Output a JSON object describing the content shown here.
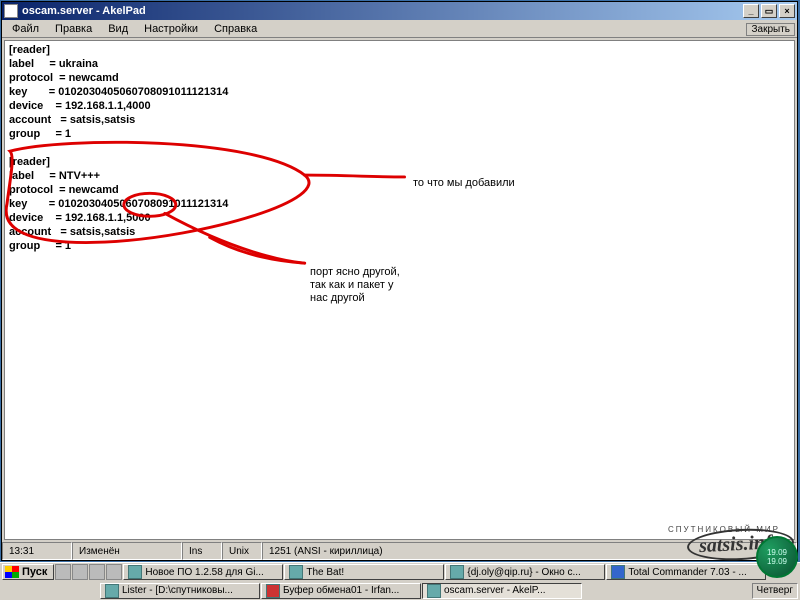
{
  "window": {
    "title": "oscam.server - AkelPad",
    "close_helper": "Закрыть"
  },
  "menu": {
    "file": "Файл",
    "edit": "Правка",
    "view": "Вид",
    "settings": "Настройки",
    "help": "Справка"
  },
  "editor_text": "[reader]\nlabel     = ukraina\nprotocol  = newcamd\nkey       = 0102030405060708091011121314\ndevice    = 192.168.1.1,4000\naccount   = satsis,satsis\ngroup     = 1\n\n[reader]\nlabel     = NTV+++\nprotocol  = newcamd\nkey       = 0102030405060708091011121314\ndevice    = 192.168.1.1,5000\naccount   = satsis,satsis\ngroup     = 1",
  "annotations": {
    "added": "то что мы добавили",
    "port": "порт ясно другой,\nтак как и пакет у\nнас другой"
  },
  "statusbar": {
    "pos": "13:31",
    "modified": "Изменён",
    "ins": "Ins",
    "eol": "Unix",
    "codepage": "1251 (ANSI - кириллица)"
  },
  "taskbar": {
    "start": "Пуск",
    "tasks_row1": [
      "Новое ПО 1.2.58 для Gi...",
      "The Bat!",
      "{dj.oly@qip.ru} - Окно с...",
      "Total Commander 7.03 - ..."
    ],
    "tasks_row2": [
      "Lister - [D:\\спутниковы...",
      "Буфер обмена01 - Irfan...",
      "oscam.server - AkelP..."
    ]
  },
  "clock": {
    "time": "19.09",
    "sec": "19.09"
  },
  "watermark": {
    "text": "satsis.info",
    "arc": "СПУТНИКОВЫЙ МИР",
    "day": "Четверг"
  }
}
